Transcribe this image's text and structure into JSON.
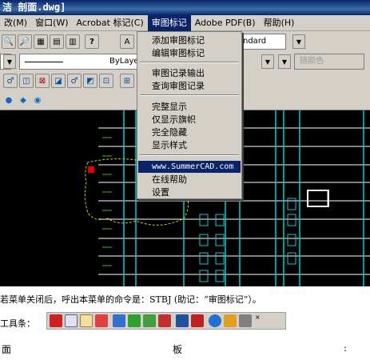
{
  "window": {
    "title": "洁 剖面.dwg]"
  },
  "menubar": {
    "items": [
      {
        "label": "改(M)"
      },
      {
        "label": "窗口(W)"
      },
      {
        "label": "Acrobat 标记(C)"
      },
      {
        "label": "审图标记"
      },
      {
        "label": "Adobe PDF(B)"
      },
      {
        "label": "帮助(H)"
      }
    ],
    "active_index": 3
  },
  "toolbar": {
    "style_combo_value": "ndard",
    "linetype_combo_value": "ByLaye",
    "color_combo_value": "随颜色"
  },
  "dropdown": {
    "items": [
      {
        "label": "添加审图标记"
      },
      {
        "label": "编辑审图标记"
      },
      {
        "label": "审图记录输出"
      },
      {
        "label": "查询审图记录"
      },
      {
        "label": "完整显示"
      },
      {
        "label": "仅显示旗帜"
      },
      {
        "label": "完全隐藏"
      },
      {
        "label": "显示样式"
      },
      {
        "label": "www.SummerCAD.com",
        "highlighted": true
      },
      {
        "label": "在线帮助"
      },
      {
        "label": "设置"
      }
    ]
  },
  "body": {
    "caption": "若菜单关闭后，呼出本菜单的命令是：STBJ (助记：“审图标记”）。",
    "toolbar_label": "工具条：",
    "panel_label": {
      "a": "面",
      "b": "板",
      "c": ":"
    }
  },
  "colors": {
    "menu_highlight": "#0a246a",
    "chrome": "#d4d0c8",
    "canvas": "#000000"
  }
}
